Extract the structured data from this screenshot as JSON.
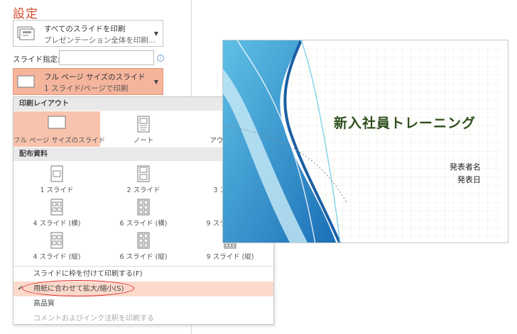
{
  "settings_title": "設定",
  "print_range": {
    "line1": "すべてのスライドを印刷",
    "line2": "プレゼンテーション全体を印刷..."
  },
  "slide_range": {
    "label": "スライド指定:",
    "value": "",
    "info_symbol": "i"
  },
  "layout_dropdown": {
    "line1": "フル ページ サイズのスライド",
    "line2": "1 スライド/ページで印刷",
    "accent_color": "#f5b59d"
  },
  "menu": {
    "print_layout_header": "印刷レイアウト",
    "layouts": [
      {
        "label": "フル ページ サイズのスライド",
        "selected": true
      },
      {
        "label": "ノート",
        "selected": false
      },
      {
        "label": "アウトライン",
        "selected": false
      }
    ],
    "handouts_header": "配布資料",
    "handouts": [
      {
        "label": "1 スライド"
      },
      {
        "label": "2 スライド"
      },
      {
        "label": "3 スライド"
      },
      {
        "label": "4 スライド (横)"
      },
      {
        "label": "6 スライド (横)"
      },
      {
        "label": "9 スライド (横)"
      },
      {
        "label": "4 スライド (縦)"
      },
      {
        "label": "6 スライド (縦)"
      },
      {
        "label": "9 スライド (縦)"
      }
    ],
    "options": {
      "frame": "スライドに枠を付けて印刷する(F)",
      "fit": "用紙に合わせて拡大/縮小(S)",
      "fit_checked": true,
      "high_quality": "高品質",
      "comments": "コメントおよびインク注釈を印刷する"
    }
  },
  "preview": {
    "title": "新入社員トレーニング",
    "presenter": "発表者名",
    "date": "発表日"
  }
}
